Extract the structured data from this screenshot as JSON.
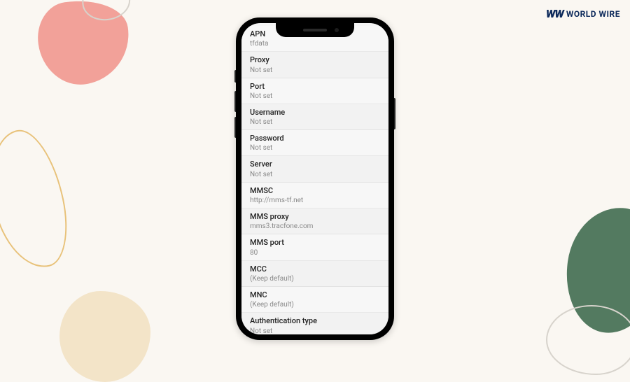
{
  "brand": {
    "mark": "WW",
    "name": "WORLD WIRE"
  },
  "settings": {
    "rows": [
      {
        "label": "APN",
        "value": "tfdata"
      },
      {
        "label": "Proxy",
        "value": "Not set"
      },
      {
        "label": "Port",
        "value": "Not set"
      },
      {
        "label": "Username",
        "value": "Not set"
      },
      {
        "label": "Password",
        "value": "Not set"
      },
      {
        "label": "Server",
        "value": "Not set"
      },
      {
        "label": "MMSC",
        "value": "http://mms-tf.net"
      },
      {
        "label": "MMS proxy",
        "value": "mms3.tracfone.com"
      },
      {
        "label": "MMS port",
        "value": "80"
      },
      {
        "label": "MCC",
        "value": "(Keep default)"
      },
      {
        "label": "MNC",
        "value": "(Keep default)"
      },
      {
        "label": "Authentication type",
        "value": "Not set"
      }
    ]
  }
}
